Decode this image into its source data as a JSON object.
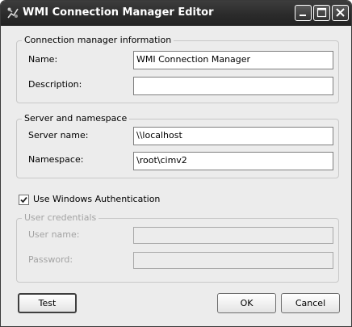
{
  "window": {
    "title": "WMI Connection Manager Editor",
    "icon": "wmi-connection-icon",
    "buttons": [
      "minimize-icon",
      "maximize-icon",
      "close-icon"
    ]
  },
  "connection_group": {
    "label": "Connection manager information",
    "name_label": "Name:",
    "name_value": "WMI Connection Manager",
    "description_label": "Description:",
    "description_value": ""
  },
  "server_group": {
    "label": "Server and namespace",
    "server_label": "Server name:",
    "server_value": "\\\\localhost",
    "namespace_label": "Namespace:",
    "namespace_value": "\\root\\cimv2"
  },
  "auth": {
    "label": "Use Windows Authentication",
    "checked": true
  },
  "credentials_group": {
    "label": "User credentials",
    "username_label": "User name:",
    "username_value": "",
    "password_label": "Password:",
    "password_value": ""
  },
  "buttons": {
    "test": "Test",
    "ok": "OK",
    "cancel": "Cancel"
  }
}
